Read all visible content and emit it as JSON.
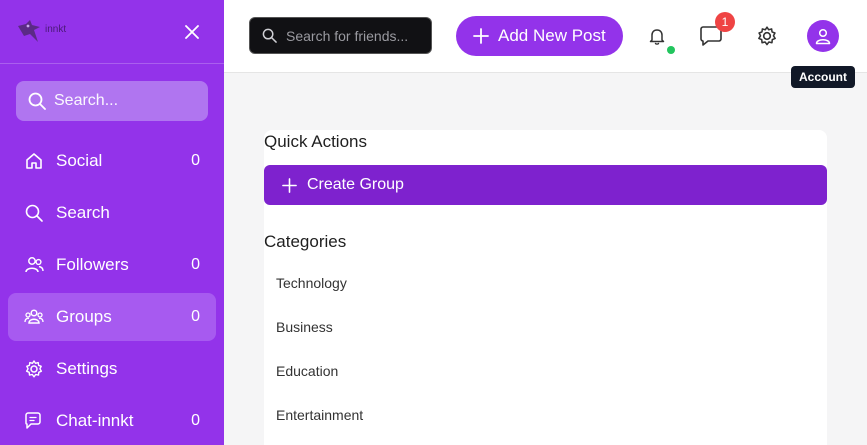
{
  "colors": {
    "brand": "#9333ea",
    "brand_dark": "#7e22ce",
    "badge": "#ef4444",
    "online": "#22c55e"
  },
  "sidebar": {
    "logo_text": "innkt",
    "search_placeholder": "Search...",
    "items": [
      {
        "label": "Social",
        "count": "0",
        "icon": "home-icon"
      },
      {
        "label": "Search",
        "count": "",
        "icon": "search-icon"
      },
      {
        "label": "Followers",
        "count": "0",
        "icon": "users-icon"
      },
      {
        "label": "Groups",
        "count": "0",
        "icon": "groups-icon",
        "active": true
      },
      {
        "label": "Settings",
        "count": "",
        "icon": "gear-icon"
      },
      {
        "label": "Chat-innkt",
        "count": "0",
        "icon": "chat-icon"
      }
    ]
  },
  "header": {
    "search_placeholder": "Search for friends...",
    "add_post_label": "Add New Post",
    "messages_badge": "1",
    "account_tooltip": "Account"
  },
  "main": {
    "quick_actions_title": "Quick Actions",
    "create_group_label": "Create Group",
    "categories_title": "Categories",
    "categories": [
      "Technology",
      "Business",
      "Education",
      "Entertainment"
    ]
  }
}
